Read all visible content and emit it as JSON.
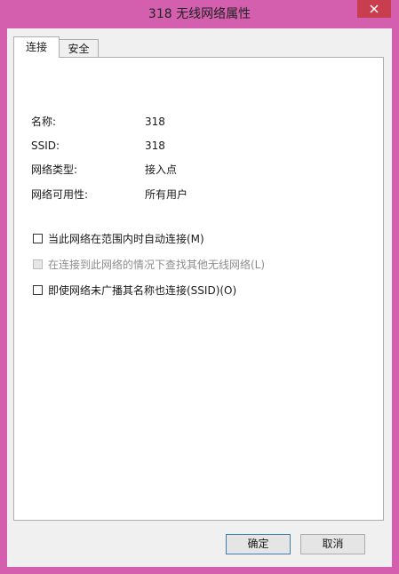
{
  "window": {
    "title": "318 无线网络属性"
  },
  "tabs": [
    {
      "label": "连接",
      "active": true
    },
    {
      "label": "安全",
      "active": false
    }
  ],
  "properties": [
    {
      "label": "名称:",
      "value": "318"
    },
    {
      "label": "SSID:",
      "value": "318"
    },
    {
      "label": "网络类型:",
      "value": "接入点"
    },
    {
      "label": "网络可用性:",
      "value": "所有用户"
    }
  ],
  "options": [
    {
      "label": "当此网络在范围内时自动连接(M)",
      "checked": false,
      "enabled": true
    },
    {
      "label": "在连接到此网络的情况下查找其他无线网络(L)",
      "checked": false,
      "enabled": false
    },
    {
      "label": "即使网络未广播其名称也连接(SSID)(O)",
      "checked": false,
      "enabled": true
    }
  ],
  "buttons": {
    "ok": "确定",
    "cancel": "取消"
  },
  "colors": {
    "frame": "#d35fae",
    "close": "#c93e4e",
    "panel": "#ffffff"
  },
  "icons": {
    "close": "close-icon"
  }
}
